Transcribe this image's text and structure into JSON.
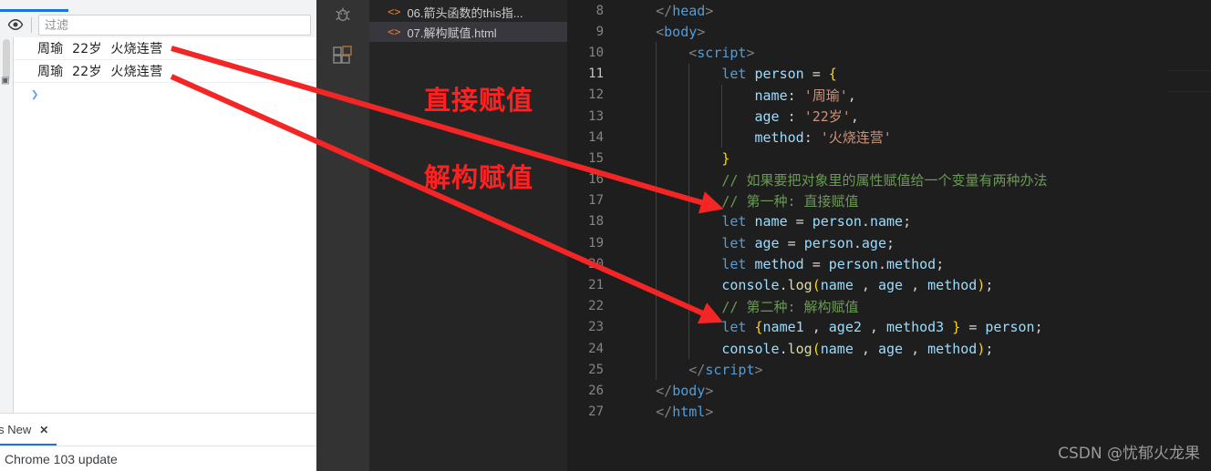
{
  "devtools": {
    "toolbar": {
      "eye_icon": "eye-icon",
      "filter_placeholder": "过滤",
      "filter_value": ""
    },
    "console_messages": [
      {
        "text": "周瑜  22岁  火烧连营"
      },
      {
        "text": "周瑜  22岁  火烧连营"
      }
    ],
    "prompt_glyph": "❯",
    "error_glyph": "▣",
    "bottom_tabs": [
      {
        "label": "t's New",
        "close_label": "✕",
        "active": true
      }
    ],
    "status_text": "Chrome 103 update"
  },
  "activity_bar": {
    "items": [
      {
        "icon": "bug-debug-icon",
        "name": "run-and-debug"
      },
      {
        "icon": "extensions-icon",
        "name": "extensions"
      }
    ]
  },
  "sidepanel": {
    "files": [
      {
        "icon": "html-file-icon",
        "label": "06.箭头函数的this指...",
        "selected": false
      },
      {
        "icon": "html-file-icon",
        "label": "07.解构赋值.html",
        "selected": true
      }
    ]
  },
  "annotations": [
    {
      "label": "直接赋值",
      "color": "#ff2020"
    },
    {
      "label": "解构赋值",
      "color": "#ff2020"
    }
  ],
  "editor": {
    "lines": [
      {
        "num": "8",
        "active": false,
        "indent_guides": [],
        "tokens": [
          {
            "c": "t-plain",
            "t": "    "
          },
          {
            "c": "t-punct",
            "t": "</"
          },
          {
            "c": "t-tag",
            "t": "head"
          },
          {
            "c": "t-punct",
            "t": ">"
          }
        ]
      },
      {
        "num": "9",
        "active": false,
        "indent_guides": [],
        "tokens": [
          {
            "c": "t-plain",
            "t": "    "
          },
          {
            "c": "t-punct",
            "t": "<"
          },
          {
            "c": "t-tag",
            "t": "body"
          },
          {
            "c": "t-punct",
            "t": ">"
          }
        ]
      },
      {
        "num": "10",
        "active": false,
        "indent_guides": [
          0
        ],
        "tokens": [
          {
            "c": "t-plain",
            "t": "        "
          },
          {
            "c": "t-punct",
            "t": "<"
          },
          {
            "c": "t-tag",
            "t": "script"
          },
          {
            "c": "t-punct",
            "t": ">"
          }
        ]
      },
      {
        "num": "11",
        "active": true,
        "indent_guides": [
          0,
          1
        ],
        "tokens": [
          {
            "c": "t-plain",
            "t": "            "
          },
          {
            "c": "t-kw",
            "t": "let"
          },
          {
            "c": "t-plain",
            "t": " "
          },
          {
            "c": "t-var",
            "t": "person"
          },
          {
            "c": "t-plain",
            "t": " "
          },
          {
            "c": "t-op",
            "t": "="
          },
          {
            "c": "t-plain",
            "t": " "
          },
          {
            "c": "t-brace",
            "t": "{"
          }
        ]
      },
      {
        "num": "12",
        "active": false,
        "indent_guides": [
          0,
          1,
          2
        ],
        "tokens": [
          {
            "c": "t-plain",
            "t": "                "
          },
          {
            "c": "t-var",
            "t": "name"
          },
          {
            "c": "t-op",
            "t": ":"
          },
          {
            "c": "t-plain",
            "t": " "
          },
          {
            "c": "t-str",
            "t": "'周瑜'"
          },
          {
            "c": "t-plain",
            "t": ","
          }
        ]
      },
      {
        "num": "13",
        "active": false,
        "indent_guides": [
          0,
          1,
          2
        ],
        "tokens": [
          {
            "c": "t-plain",
            "t": "                "
          },
          {
            "c": "t-var",
            "t": "age"
          },
          {
            "c": "t-plain",
            "t": " "
          },
          {
            "c": "t-op",
            "t": ":"
          },
          {
            "c": "t-plain",
            "t": " "
          },
          {
            "c": "t-str",
            "t": "'22岁'"
          },
          {
            "c": "t-plain",
            "t": ","
          }
        ]
      },
      {
        "num": "14",
        "active": false,
        "indent_guides": [
          0,
          1,
          2
        ],
        "tokens": [
          {
            "c": "t-plain",
            "t": "                "
          },
          {
            "c": "t-var",
            "t": "method"
          },
          {
            "c": "t-op",
            "t": ":"
          },
          {
            "c": "t-plain",
            "t": " "
          },
          {
            "c": "t-str",
            "t": "'火烧连营'"
          }
        ]
      },
      {
        "num": "15",
        "active": false,
        "indent_guides": [
          0,
          1
        ],
        "tokens": [
          {
            "c": "t-plain",
            "t": "            "
          },
          {
            "c": "t-brace",
            "t": "}"
          }
        ]
      },
      {
        "num": "16",
        "active": false,
        "indent_guides": [
          0,
          1
        ],
        "tokens": [
          {
            "c": "t-plain",
            "t": "            "
          },
          {
            "c": "t-comment",
            "t": "// 如果要把对象里的属性赋值给一个变量有两种办法"
          }
        ]
      },
      {
        "num": "17",
        "active": false,
        "indent_guides": [
          0,
          1
        ],
        "tokens": [
          {
            "c": "t-plain",
            "t": "            "
          },
          {
            "c": "t-comment",
            "t": "// 第一种: 直接赋值"
          }
        ]
      },
      {
        "num": "18",
        "active": false,
        "indent_guides": [
          0,
          1
        ],
        "tokens": [
          {
            "c": "t-plain",
            "t": "            "
          },
          {
            "c": "t-kw",
            "t": "let"
          },
          {
            "c": "t-plain",
            "t": " "
          },
          {
            "c": "t-var",
            "t": "name"
          },
          {
            "c": "t-plain",
            "t": " "
          },
          {
            "c": "t-op",
            "t": "="
          },
          {
            "c": "t-plain",
            "t": " "
          },
          {
            "c": "t-var",
            "t": "person"
          },
          {
            "c": "t-plain",
            "t": "."
          },
          {
            "c": "t-var",
            "t": "name"
          },
          {
            "c": "t-plain",
            "t": ";"
          }
        ]
      },
      {
        "num": "19",
        "active": false,
        "indent_guides": [
          0,
          1
        ],
        "tokens": [
          {
            "c": "t-plain",
            "t": "            "
          },
          {
            "c": "t-kw",
            "t": "let"
          },
          {
            "c": "t-plain",
            "t": " "
          },
          {
            "c": "t-var",
            "t": "age"
          },
          {
            "c": "t-plain",
            "t": " "
          },
          {
            "c": "t-op",
            "t": "="
          },
          {
            "c": "t-plain",
            "t": " "
          },
          {
            "c": "t-var",
            "t": "person"
          },
          {
            "c": "t-plain",
            "t": "."
          },
          {
            "c": "t-var",
            "t": "age"
          },
          {
            "c": "t-plain",
            "t": ";"
          }
        ]
      },
      {
        "num": "20",
        "active": false,
        "indent_guides": [
          0,
          1
        ],
        "tokens": [
          {
            "c": "t-plain",
            "t": "            "
          },
          {
            "c": "t-kw",
            "t": "let"
          },
          {
            "c": "t-plain",
            "t": " "
          },
          {
            "c": "t-var",
            "t": "method"
          },
          {
            "c": "t-plain",
            "t": " "
          },
          {
            "c": "t-op",
            "t": "="
          },
          {
            "c": "t-plain",
            "t": " "
          },
          {
            "c": "t-var",
            "t": "person"
          },
          {
            "c": "t-plain",
            "t": "."
          },
          {
            "c": "t-var",
            "t": "method"
          },
          {
            "c": "t-plain",
            "t": ";"
          }
        ]
      },
      {
        "num": "21",
        "active": false,
        "indent_guides": [
          0,
          1
        ],
        "tokens": [
          {
            "c": "t-plain",
            "t": "            "
          },
          {
            "c": "t-var",
            "t": "console"
          },
          {
            "c": "t-plain",
            "t": "."
          },
          {
            "c": "t-fn",
            "t": "log"
          },
          {
            "c": "t-paren",
            "t": "("
          },
          {
            "c": "t-var",
            "t": "name"
          },
          {
            "c": "t-plain",
            "t": " , "
          },
          {
            "c": "t-var",
            "t": "age"
          },
          {
            "c": "t-plain",
            "t": " , "
          },
          {
            "c": "t-var",
            "t": "method"
          },
          {
            "c": "t-paren",
            "t": ")"
          },
          {
            "c": "t-plain",
            "t": ";"
          }
        ]
      },
      {
        "num": "22",
        "active": false,
        "indent_guides": [
          0,
          1
        ],
        "tokens": [
          {
            "c": "t-plain",
            "t": "            "
          },
          {
            "c": "t-comment",
            "t": "// 第二种: 解构赋值"
          }
        ]
      },
      {
        "num": "23",
        "active": false,
        "indent_guides": [
          0,
          1
        ],
        "tokens": [
          {
            "c": "t-plain",
            "t": "            "
          },
          {
            "c": "t-kw",
            "t": "let"
          },
          {
            "c": "t-plain",
            "t": " "
          },
          {
            "c": "t-brace",
            "t": "{"
          },
          {
            "c": "t-var",
            "t": "name1"
          },
          {
            "c": "t-plain",
            "t": " , "
          },
          {
            "c": "t-var",
            "t": "age2"
          },
          {
            "c": "t-plain",
            "t": " , "
          },
          {
            "c": "t-var",
            "t": "method3"
          },
          {
            "c": "t-plain",
            "t": " "
          },
          {
            "c": "t-brace",
            "t": "}"
          },
          {
            "c": "t-plain",
            "t": " "
          },
          {
            "c": "t-op",
            "t": "="
          },
          {
            "c": "t-plain",
            "t": " "
          },
          {
            "c": "t-var",
            "t": "person"
          },
          {
            "c": "t-plain",
            "t": ";"
          }
        ]
      },
      {
        "num": "24",
        "active": false,
        "indent_guides": [
          0,
          1
        ],
        "tokens": [
          {
            "c": "t-plain",
            "t": "            "
          },
          {
            "c": "t-var",
            "t": "console"
          },
          {
            "c": "t-plain",
            "t": "."
          },
          {
            "c": "t-fn",
            "t": "log"
          },
          {
            "c": "t-paren",
            "t": "("
          },
          {
            "c": "t-var",
            "t": "name"
          },
          {
            "c": "t-plain",
            "t": " , "
          },
          {
            "c": "t-var",
            "t": "age"
          },
          {
            "c": "t-plain",
            "t": " , "
          },
          {
            "c": "t-var",
            "t": "method"
          },
          {
            "c": "t-paren",
            "t": ")"
          },
          {
            "c": "t-plain",
            "t": ";"
          }
        ]
      },
      {
        "num": "25",
        "active": false,
        "indent_guides": [
          0
        ],
        "tokens": [
          {
            "c": "t-plain",
            "t": "        "
          },
          {
            "c": "t-punct",
            "t": "</"
          },
          {
            "c": "t-tag",
            "t": "script"
          },
          {
            "c": "t-punct",
            "t": ">"
          }
        ]
      },
      {
        "num": "26",
        "active": false,
        "indent_guides": [],
        "tokens": [
          {
            "c": "t-plain",
            "t": "    "
          },
          {
            "c": "t-punct",
            "t": "</"
          },
          {
            "c": "t-tag",
            "t": "body"
          },
          {
            "c": "t-punct",
            "t": ">"
          }
        ]
      },
      {
        "num": "27",
        "active": false,
        "indent_guides": [],
        "tokens": [
          {
            "c": "t-plain",
            "t": "    "
          },
          {
            "c": "t-punct",
            "t": "</"
          },
          {
            "c": "t-tag",
            "t": "html"
          },
          {
            "c": "t-punct",
            "t": ">"
          }
        ]
      }
    ]
  },
  "watermark": "CSDN @忧郁火龙果",
  "colors": {
    "accent_blue": "#1a73e8",
    "annotation_red": "#ff2020",
    "editor_bg": "#1e1e1e",
    "sidepanel_bg": "#252526",
    "activitybar_bg": "#333333"
  }
}
